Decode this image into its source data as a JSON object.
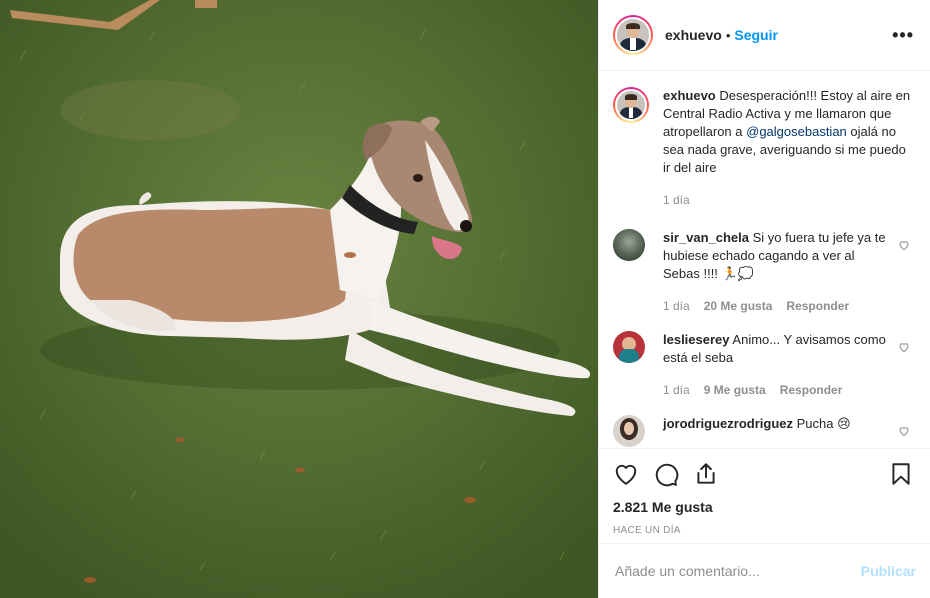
{
  "post": {
    "author": "exhuevo",
    "separator": "•",
    "follow_label": "Seguir",
    "more_label": "•••",
    "caption": {
      "username": "exhuevo",
      "text_before": "Desesperación!!! Estoy al aire en Central Radio Activa y me llamaron que atropellaron a ",
      "mention": "@galgosebastian",
      "text_after": " ojalá no sea nada grave, averiguando si me puedo ir del aire",
      "time": "1 día"
    },
    "comments": [
      {
        "username": "sir_van_chela",
        "text": "Si yo fuera tu jefe ya te hubiese echado cagando a ver al Sebas !!!! 🏃💭",
        "time": "1 día",
        "likes": "20 Me gusta",
        "reply": "Responder"
      },
      {
        "username": "leslieserey",
        "text": "Animo... Y avisamos como está el seba",
        "time": "1 día",
        "likes": "9 Me gusta",
        "reply": "Responder"
      },
      {
        "username": "jorodriguezrodriguez",
        "text": "Pucha 😢",
        "time": "",
        "likes": "",
        "reply": ""
      }
    ],
    "likes_count": "2.821 Me gusta",
    "timestamp": "Hace un día",
    "comment_placeholder": "Añade un comentario...",
    "publish_label": "Publicar"
  },
  "icons": [
    "heart-icon",
    "comment-icon",
    "share-icon",
    "bookmark-icon",
    "more-icon"
  ],
  "colors": {
    "link": "#0095f6",
    "publish_disabled": "#b2dffc",
    "meta": "#8e8e8e"
  }
}
